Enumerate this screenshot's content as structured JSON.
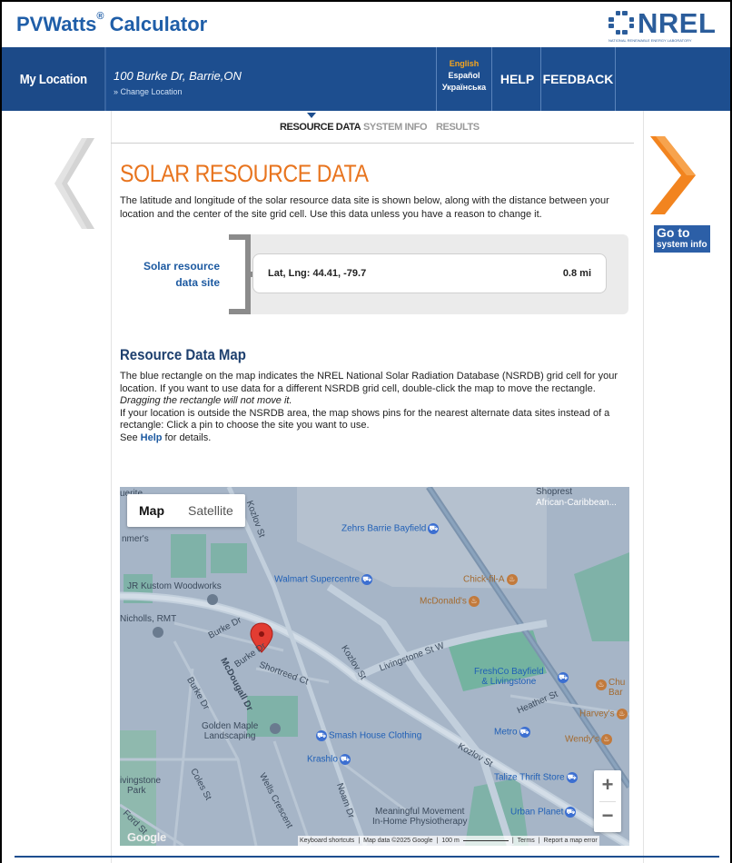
{
  "header": {
    "app_name": "PVWatts",
    "trademark": "®",
    "app_suffix": "Calculator",
    "logo_text": "NREL",
    "logo_subtext": "NATIONAL RENEWABLE ENERGY LABORATORY"
  },
  "nav": {
    "my_location": "My Location",
    "address": "100 Burke Dr, Barrie,ON",
    "change_location": "» Change Location",
    "languages": [
      "English",
      "Español",
      "Українська"
    ],
    "active_language": "English",
    "help": "HELP",
    "feedback": "FEEDBACK"
  },
  "steps": {
    "resource": "RESOURCE DATA",
    "system": "SYSTEM INFO",
    "results": "RESULTS",
    "active": "RESOURCE DATA"
  },
  "page": {
    "title": "SOLAR RESOURCE DATA",
    "intro": "The latitude and longitude of the solar resource data site is shown below, along with the distance between your location and the center of the site grid cell. Use this data unless you have a reason to change it.",
    "site_label_1": "Solar resource",
    "site_label_2": "data site",
    "site_coords": "Lat, Lng: 44.41, -79.7",
    "site_distance": "0.8 mi",
    "goto_line1": "Go to",
    "goto_line2": "system info"
  },
  "map_section": {
    "heading": "Resource Data Map",
    "p1": "The blue rectangle on the map indicates the NREL National Solar Radiation Database (NSRDB) grid cell for your location. If you want to use data for a different NSRDB grid cell, double-click the map to move the rectangle.",
    "p1_em": "Dragging the rectangle will not move it.",
    "p2": "If your location is outside the NSRDB area, the map shows pins for the nearest alternate data sites instead of a rectangle: Click a pin to choose the site you want to use.",
    "p3_pre": "See",
    "p3_link": "Help",
    "p3_post": "for details."
  },
  "map": {
    "type_map": "Map",
    "type_satellite": "Satellite",
    "zoom_in": "+",
    "zoom_out": "−",
    "google": "Google",
    "footer": [
      "Keyboard shortcuts",
      "Map data ©2025 Google",
      "100 m",
      "Terms",
      "Report a map error"
    ],
    "labels": {
      "zehrs": "Zehrs Barrie Bayfield",
      "walmart": "Walmart Supercentre",
      "chickfila": "Chick-fil-A",
      "mcdonalds": "McDonald's",
      "jr": "JR Kustom Woodworks",
      "nicholls": "Nicholls, RMT",
      "freshco1": "FreshCo Bayfield",
      "freshco2": "& Livingstone",
      "golden1": "Golden Maple",
      "golden2": "Landscaping",
      "smash": "Smash House Clothing",
      "krashlo": "Krashlo",
      "metro": "Metro",
      "harveys": "Harvey's",
      "wendys": "Wendy's",
      "talize": "Talize Thrift Store",
      "urban": "Urban Planet",
      "meaningful1": "Meaningful Movement",
      "meaningful2": "In-Home Physiotherapy",
      "livingstone_park1": "ivingstone",
      "livingstone_park2": "Park",
      "shoprest": "Shoprest",
      "african": "African-Caribbean...",
      "chu1": "Chu",
      "chu2": "Bar",
      "quertite": "uerite",
      "livingstone_st": "Livingstone St W",
      "kozlov": "Kozlov St",
      "kozlov2": "Kozlov St",
      "kozlov3": "Kozlov St",
      "heather": "Heather St",
      "burke1": "Burke Dr",
      "burke2": "Burke Dr",
      "burke3": "Burke Dr",
      "mcdougall": "McDougall Dr",
      "shortreed": "Shortreed Ct",
      "coles": "Coles St",
      "wells": "Wells Crescent",
      "noam": "Noam Dr",
      "ford": "Ford St",
      "cunners": "nmer's"
    }
  }
}
